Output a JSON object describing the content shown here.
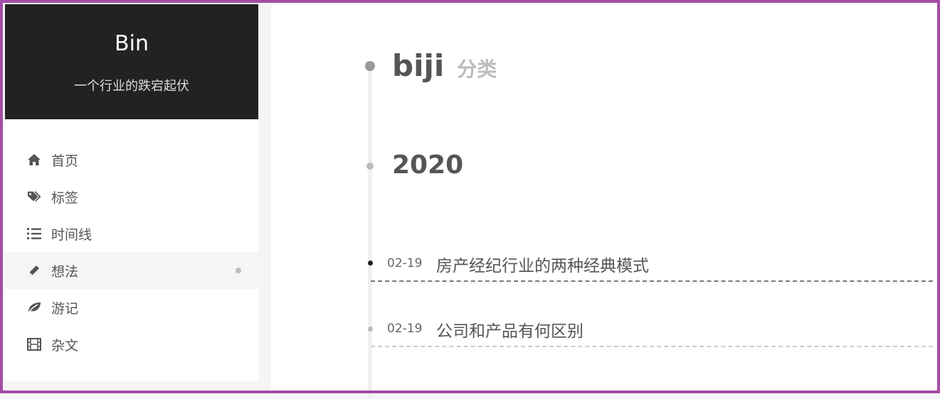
{
  "brand": {
    "title": "Bin",
    "subtitle": "一个行业的跌宕起伏"
  },
  "menu": {
    "items": [
      {
        "label": "首页",
        "icon": "home-icon"
      },
      {
        "label": "标签",
        "icon": "tags-icon"
      },
      {
        "label": "时间线",
        "icon": "timeline-list-icon"
      },
      {
        "label": "想法",
        "icon": "pencil-icon",
        "active": true
      },
      {
        "label": "游记",
        "icon": "leaf-icon"
      },
      {
        "label": "杂文",
        "icon": "film-icon"
      }
    ]
  },
  "category": {
    "name": "biji",
    "suffix": "分类"
  },
  "year": "2020",
  "posts": [
    {
      "date": "02-19",
      "title": "房产经纪行业的两种经典模式"
    },
    {
      "date": "02-19",
      "title": "公司和产品有何区别"
    }
  ],
  "colors": {
    "brand_bg": "#222222",
    "frame": "#a64ca6",
    "text": "#555555",
    "muted": "#bbbbbb"
  }
}
